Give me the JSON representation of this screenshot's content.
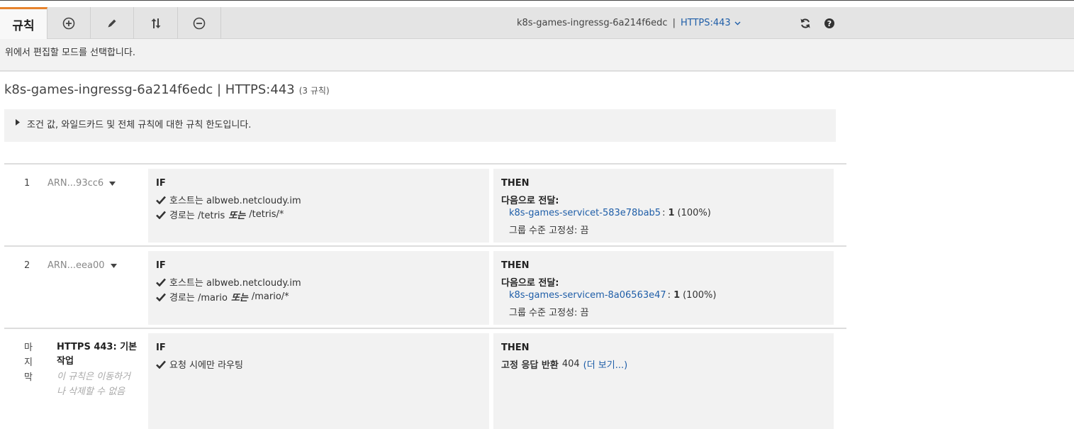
{
  "toolbar": {
    "tab_rules": "규칙",
    "icons": [
      "plus-circle-icon",
      "pencil-icon",
      "sort-icon",
      "minus-circle-icon",
      "refresh-icon",
      "help-icon"
    ],
    "lb_name": "k8s-games-ingressg-6a214f6edc",
    "separator": "|",
    "listener": "HTTPS:443",
    "accent_color": "#e7832d",
    "link_color": "#1f5ea8"
  },
  "subbar": {
    "hint": "위에서 편집할 모드를 선택합니다."
  },
  "heading": {
    "title": "k8s-games-ingressg-6a214f6edc | HTTPS:443",
    "count": "(3 규칙)"
  },
  "info": {
    "text": "조건 값, 와일드카드 및 전체 규칙에 대한 규칙 한도입니다."
  },
  "rules": [
    {
      "number": "1",
      "arn": "ARN...93cc6",
      "if_label": "IF",
      "host": "호스트는 albweb.netcloudy.im",
      "path_prefix": "경로는 /tetris",
      "path_or": "또는",
      "path_suffix": "/tetris/*",
      "then_label": "THEN",
      "forward_label": "다음으로 전달:",
      "target_group": "k8s-games-servicet-583e78bab5",
      "weight_sep": ":",
      "weight": "1",
      "percent": "(100%)",
      "stickiness": "그룹 수준 고정성: 끔"
    },
    {
      "number": "2",
      "arn": "ARN...eea00",
      "if_label": "IF",
      "host": "호스트는 albweb.netcloudy.im",
      "path_prefix": "경로는 /mario",
      "path_or": "또는",
      "path_suffix": "/mario/*",
      "then_label": "THEN",
      "forward_label": "다음으로 전달:",
      "target_group": "k8s-games-servicem-8a06563e47",
      "weight_sep": ":",
      "weight": "1",
      "percent": "(100%)",
      "stickiness": "그룹 수준 고정성: 끔"
    }
  ],
  "last_rule": {
    "number_lines": [
      "마",
      "지",
      "막"
    ],
    "name": "HTTPS 443: 기본 작업",
    "note": "이 규칙은 이동하거나 삭제할 수 없음",
    "if_label": "IF",
    "condition": "요청 시에만 라우팅",
    "then_label": "THEN",
    "action": "고정 응답 반환",
    "status_code": "404",
    "more_link": "(더 보기...)"
  }
}
